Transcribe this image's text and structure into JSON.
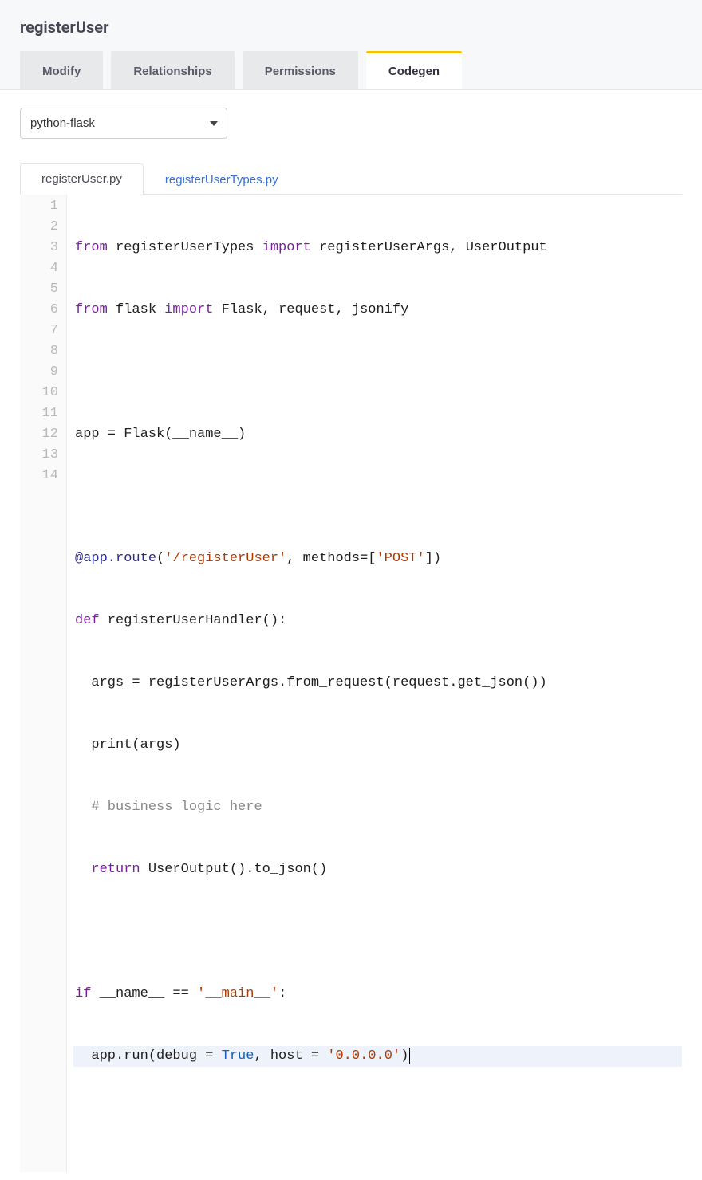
{
  "title": "registerUser",
  "tabs": [
    {
      "label": "Modify",
      "active": false
    },
    {
      "label": "Relationships",
      "active": false
    },
    {
      "label": "Permissions",
      "active": false
    },
    {
      "label": "Codegen",
      "active": true
    }
  ],
  "framework_select": {
    "value": "python-flask",
    "options": [
      "python-flask"
    ]
  },
  "file_tabs": [
    {
      "label": "registerUser.py",
      "active": true
    },
    {
      "label": "registerUserTypes.py",
      "active": false
    }
  ],
  "code": {
    "line_count": 14,
    "highlighted_line": 14,
    "tokens": {
      "l1": {
        "a": "from",
        "b": " registerUserTypes ",
        "c": "import",
        "d": " registerUserArgs, UserOutput"
      },
      "l2": {
        "a": "from",
        "b": " flask ",
        "c": "import",
        "d": " Flask, request, jsonify"
      },
      "l4": "app = Flask(__name__)",
      "l6": {
        "a": "@app.route",
        "b": "(",
        "c": "'/registerUser'",
        "d": ", methods=[",
        "e": "'POST'",
        "f": "])"
      },
      "l7": {
        "a": "def",
        "b": " registerUserHandler():"
      },
      "l8": "  args = registerUserArgs.from_request(request.get_json())",
      "l9": "  print(args)",
      "l10": {
        "a": "  ",
        "b": "# business logic here"
      },
      "l11": {
        "a": "  ",
        "b": "return",
        "c": " UserOutput().to_json()"
      },
      "l13": {
        "a": "if",
        "b": " __name__ == ",
        "c": "'__main__'",
        "d": ":"
      },
      "l14": {
        "a": "  app.run(debug = ",
        "b": "True",
        "c": ", host = ",
        "d": "'0.0.0.0'",
        "e": ")"
      }
    }
  }
}
